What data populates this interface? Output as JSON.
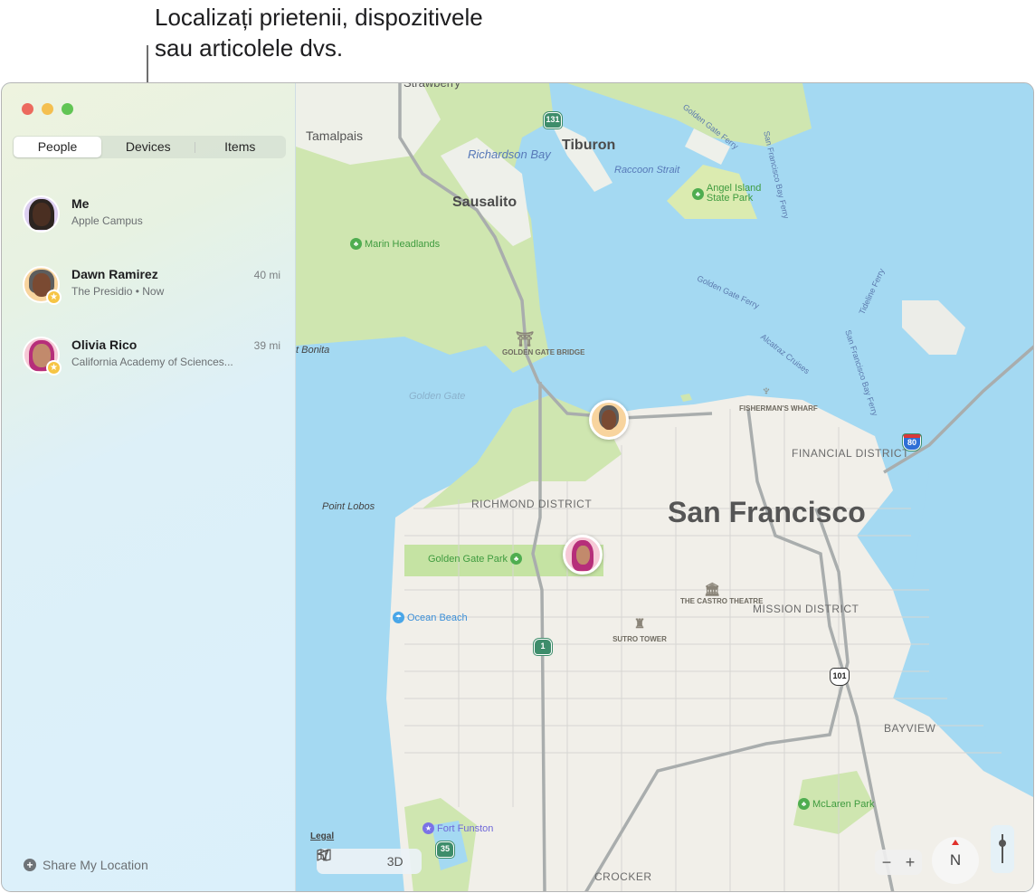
{
  "callout": {
    "line1": "Localizați prietenii, dispozitivele",
    "line2": "sau articolele dvs."
  },
  "window": {
    "traffic_lights": [
      "close",
      "minimize",
      "zoom"
    ]
  },
  "tabs": [
    {
      "label": "People",
      "active": true
    },
    {
      "label": "Devices",
      "active": false
    },
    {
      "label": "Items",
      "active": false
    }
  ],
  "people": [
    {
      "name": "Me",
      "location": "Apple Campus",
      "distance": "",
      "favorite": false,
      "avatar_bg": "#dccff0"
    },
    {
      "name": "Dawn Ramirez",
      "location": "The Presidio • Now",
      "distance": "40 mi",
      "favorite": true,
      "avatar_bg": "#f8d49e"
    },
    {
      "name": "Olivia Rico",
      "location": "California Academy of Sciences...",
      "distance": "39 mi",
      "favorite": true,
      "avatar_bg": "#f6c9d6"
    }
  ],
  "share_location": {
    "label": "Share My Location",
    "icon": "plus-circle-icon"
  },
  "map": {
    "labels": {
      "strawberry": "Strawberry",
      "tamalpais": "Tamalpais",
      "tiburon": "Tiburon",
      "richardson_bay": "Richardson Bay",
      "raccoon_strait": "Raccoon Strait",
      "sausalito": "Sausalito",
      "angel_island": "Angel Island State Park",
      "marin_headlands": "Marin Headlands",
      "point_bonita": "t Bonita",
      "golden_gate_bridge": "GOLDEN GATE BRIDGE",
      "golden_gate": "Golden Gate",
      "fishermans_wharf": "FISHERMAN'S WHARF",
      "financial_district": "FINANCIAL DISTRICT",
      "point_lobos": "Point Lobos",
      "richmond_district": "RICHMOND DISTRICT",
      "san_francisco": "San Francisco",
      "golden_gate_park": "Golden Gate Park",
      "ocean_beach": "Ocean Beach",
      "castro_theatre": "THE CASTRO THEATRE",
      "mission_district": "MISSION DISTRICT",
      "sutro_tower": "SUTRO TOWER",
      "bayview": "BAYVIEW",
      "mclaren_park": "McLaren Park",
      "fort_funston": "Fort Funston",
      "crocker": "CROCKER"
    },
    "ferries": {
      "gg_ferry_1": "Golden Gate Ferry",
      "sf_bay_ferry_1": "San Francisco Bay Ferry",
      "gg_ferry_2": "Golden Gate Ferry",
      "alcatraz": "Alcatraz Cruises",
      "tideline": "Tideline Ferry",
      "sf_bay_ferry_2": "San Francisco Bay Ferry"
    },
    "shields": {
      "r131": "131",
      "r1": "1",
      "r35": "35",
      "us101": "101",
      "i80": "80"
    },
    "legal": "Legal",
    "controls": {
      "location_icon": "location-arrow-icon",
      "map_icon": "map-icon",
      "three_d": "3D",
      "zoom_out": "−",
      "zoom_in": "+",
      "compass": "N"
    }
  }
}
